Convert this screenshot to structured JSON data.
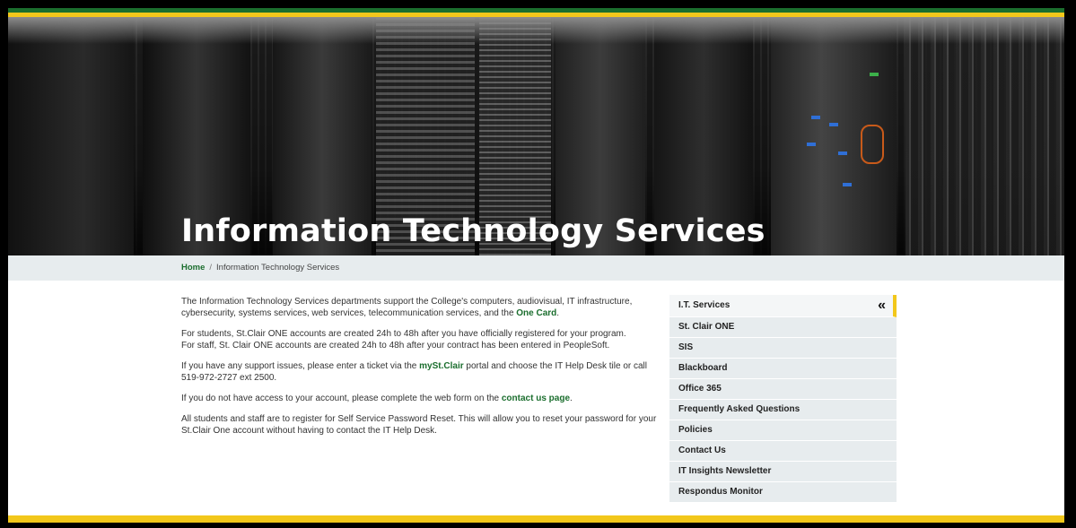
{
  "hero": {
    "title": "Information Technology Services"
  },
  "breadcrumb": {
    "home": "Home",
    "separator": "/",
    "current": "Information Technology Services"
  },
  "content": {
    "p1_text": "The Information Technology Services departments support the College's computers, audiovisual, IT infrastructure, cybersecurity, systems services, web services, telecommunication services, and the ",
    "p1_link": "One Card",
    "p1_end": ".",
    "p2_line1": "For students, St.Clair ONE accounts are created 24h to 48h after you have officially registered for your program.",
    "p2_line2": "For staff, St. Clair ONE accounts are created 24h to 48h after your contract has been entered in PeopleSoft.",
    "p3_text": "If you have any support issues, please enter a ticket via the ",
    "p3_link": "mySt.Clair",
    "p3_end": " portal and choose the IT Help Desk tile or call 519-972-2727 ext 2500.",
    "p4_text": "If you do not have access to your account, please complete the web form on the ",
    "p4_link": "contact us page",
    "p4_end": ".",
    "p5_text": "All students and staff are to register for Self Service Password Reset. This will allow you to reset your password for your St.Clair One account without having to contact the IT Help Desk."
  },
  "sidenav": {
    "header": "I.T. Services",
    "collapse_icon": "«",
    "items": [
      "St. Clair ONE",
      "SIS",
      "Blackboard",
      "Office 365",
      "Frequently Asked Questions",
      "Policies",
      "Contact Us",
      "IT Insights Newsletter",
      "Respondus Monitor"
    ]
  },
  "colors": {
    "brand_green": "#1b6e2e",
    "brand_gold": "#f2c71b",
    "nav_bg": "#e7ecee"
  }
}
